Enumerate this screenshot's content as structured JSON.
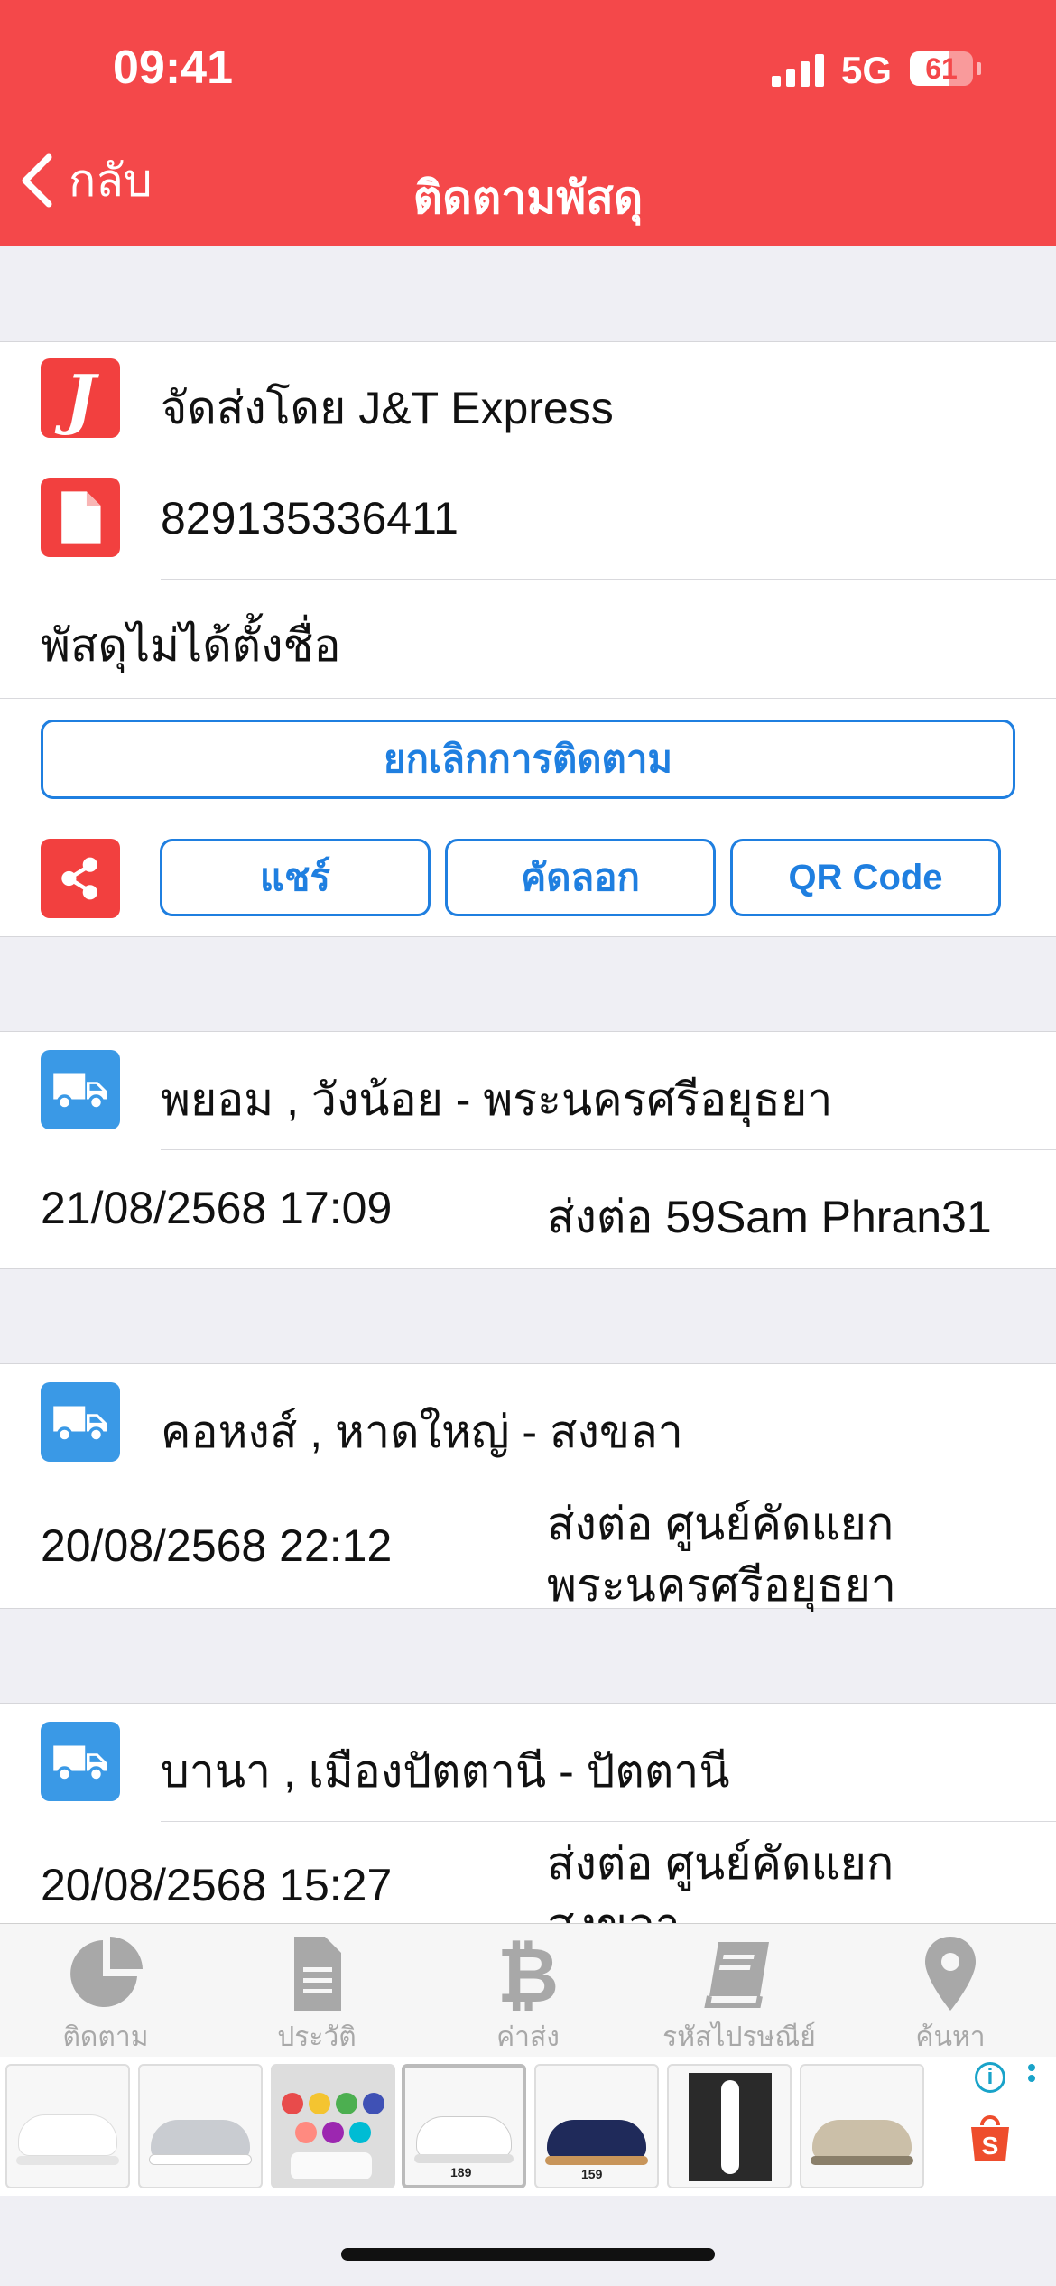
{
  "status_bar": {
    "time": "09:41",
    "network": "5G",
    "battery": "61"
  },
  "nav": {
    "back_label": "กลับ",
    "title": "ติดตามพัสดุ"
  },
  "parcel": {
    "carrier": "จัดส่งโดย J&T Express",
    "carrier_logo_letter": "J",
    "tracking_number": "829135336411",
    "parcel_name": "พัสดุไม่ได้ตั้งชื่อ",
    "cancel_button": "ยกเลิกการติดตาม",
    "share_button": "แชร์",
    "copy_button": "คัดลอก",
    "qr_button": "QR Code"
  },
  "events": [
    {
      "location": "พยอม , วังน้อย - พระนครศรีอยุธยา",
      "datetime": "21/08/2568 17:09",
      "status_line1": "ส่งต่อ 59Sam Phran31",
      "status_line2": ""
    },
    {
      "location": "คอหงส์ , หาดใหญ่ - สงขลา",
      "datetime": "20/08/2568 22:12",
      "status_line1": "ส่งต่อ ศูนย์คัดแยก",
      "status_line2": "พระนครศรีอยุธยา"
    },
    {
      "location": "บานา , เมืองปัตตานี - ปัตตานี",
      "datetime": "20/08/2568 15:27",
      "status_line1": "ส่งต่อ ศูนย์คัดแยก",
      "status_line2": "สงขลา"
    }
  ],
  "tabbar": {
    "items": [
      {
        "label": "ติดตาม",
        "icon": "pie-chart-icon"
      },
      {
        "label": "ประวัติ",
        "icon": "document-icon"
      },
      {
        "label": "ค่าส่ง",
        "icon": "bitcoin-icon"
      },
      {
        "label": "รหัสไปรษณีย์",
        "icon": "book-icon"
      },
      {
        "label": "ค้นหา",
        "icon": "location-pin-icon"
      }
    ]
  },
  "ad": {
    "prices": [
      "",
      "",
      "",
      "189",
      "159",
      "",
      ""
    ],
    "colors": {
      "brand": "#ee4d2d"
    }
  },
  "colors": {
    "header": "#f4484a",
    "accent": "#1f7fe0",
    "truck": "#3a99e6"
  }
}
